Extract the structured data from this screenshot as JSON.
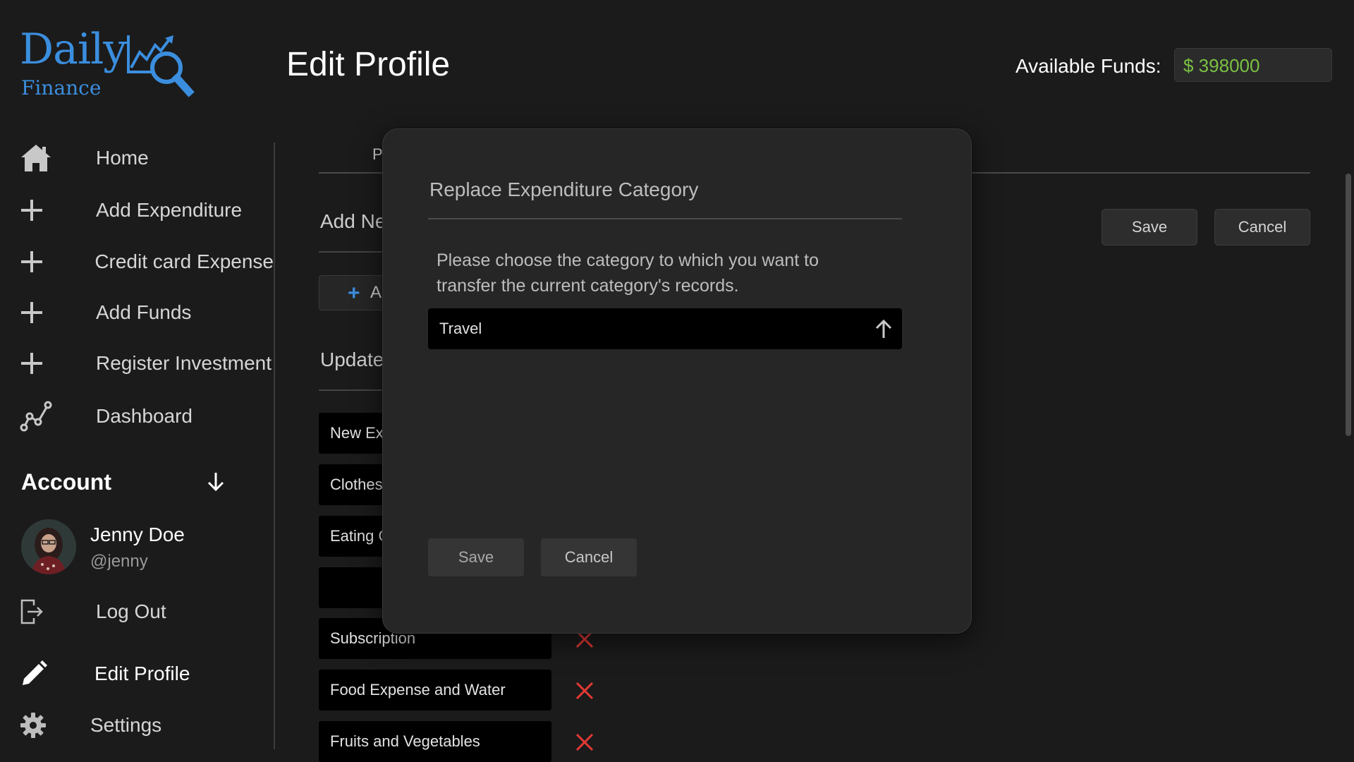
{
  "app": {
    "logo_main": "Daily",
    "logo_sub": "Finance",
    "brand_color": "#3b8ede"
  },
  "header": {
    "title": "Edit Profile",
    "funds_label": "Available Funds:",
    "funds_value": "$ 398000",
    "funds_color": "#7ac143"
  },
  "sidebar": {
    "items": [
      {
        "label": "Home",
        "icon": "home-icon"
      },
      {
        "label": "Add Expenditure",
        "icon": "plus-icon"
      },
      {
        "label": "Credit card Expense",
        "icon": "plus-icon"
      },
      {
        "label": "Add Funds",
        "icon": "plus-icon"
      },
      {
        "label": "Register Investment",
        "icon": "plus-icon"
      },
      {
        "label": "Dashboard",
        "icon": "chart-line-icon"
      }
    ],
    "account_label": "Account",
    "user": {
      "name": "Jenny Doe",
      "handle": "@jenny"
    },
    "logout_label": "Log Out",
    "edit_profile_label": "Edit Profile",
    "settings_label": "Settings"
  },
  "main": {
    "tab_partial": "P",
    "add_new_title": "Add Ne",
    "add_button_partial": "A",
    "update_title": "Update",
    "save_label": "Save",
    "cancel_label": "Cancel",
    "categories": [
      "New Ex",
      "Clothes",
      "Eating C",
      "",
      "Subscription",
      "Food Expense and Water",
      "Fruits and Vegetables"
    ]
  },
  "modal": {
    "title": "Replace Expenditure Category",
    "description": "Please choose the category to which you want to transfer the current category's records.",
    "selected_category": "Travel",
    "save_label": "Save",
    "cancel_label": "Cancel"
  },
  "colors": {
    "background": "#1b1b1b",
    "delete_red": "#e53935"
  }
}
